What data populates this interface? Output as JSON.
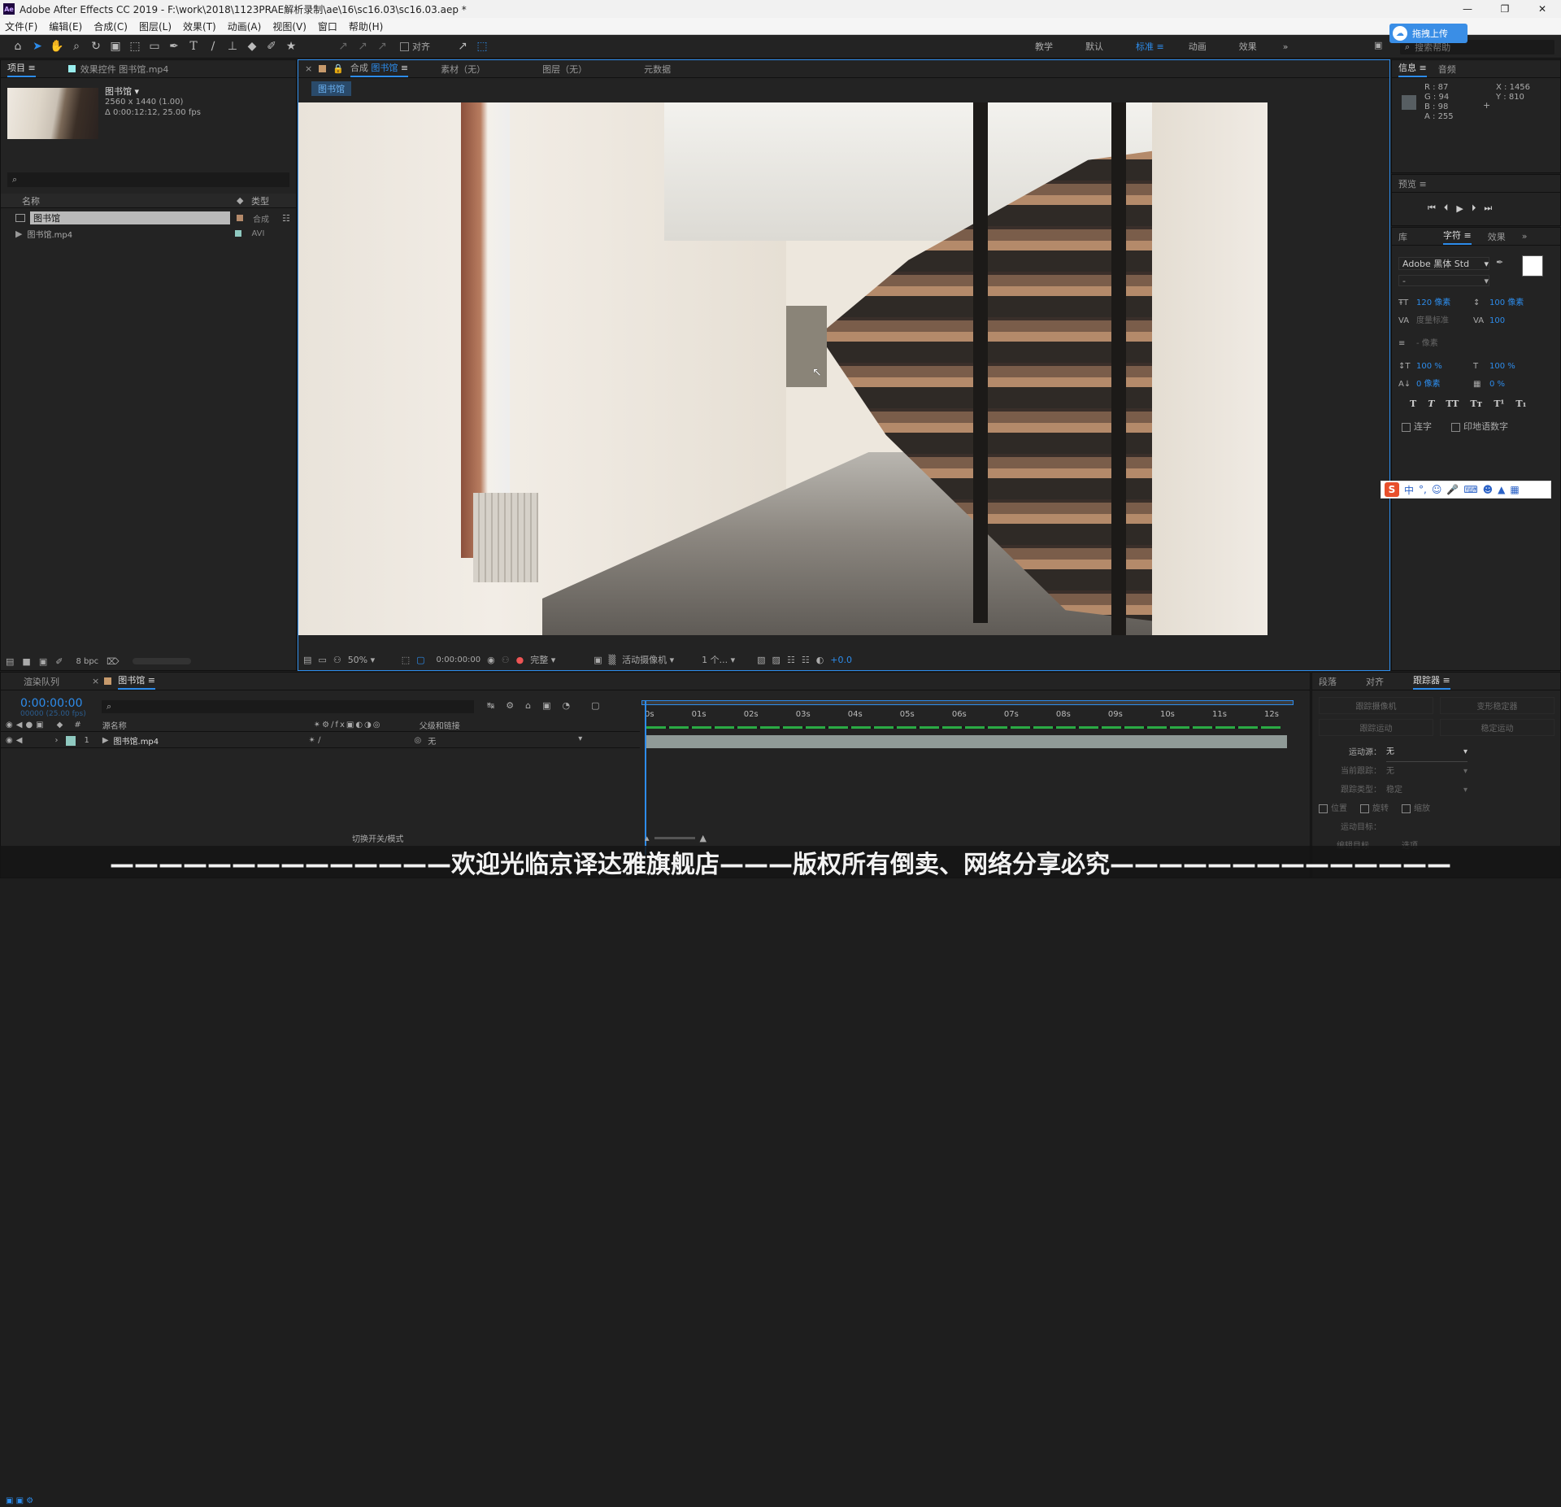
{
  "window": {
    "title": "Adobe After Effects CC 2019 - F:\\work\\2018\\1123PRAE解析录制\\ae\\16\\sc16.03\\sc16.03.aep *",
    "app_icon": "Ae"
  },
  "menu": [
    "文件(F)",
    "编辑(E)",
    "合成(C)",
    "图层(L)",
    "效果(T)",
    "动画(A)",
    "视图(V)",
    "窗口",
    "帮助(H)"
  ],
  "toolbar": {
    "align_label": "对齐",
    "workspaces": [
      "教学",
      "默认",
      "标准",
      "动画",
      "效果"
    ],
    "active_workspace": "标准",
    "search_placeholder": "搜索帮助",
    "upload_label": "拖拽上传"
  },
  "project": {
    "tab": "项目",
    "effects_tab": "效果控件 图书馆.mp4",
    "item_name": "图书馆",
    "item_size": "2560 x 1440 (1.00)",
    "item_duration": "Δ 0:00:12:12, 25.00 fps",
    "col_name": "名称",
    "col_type": "类型",
    "items": [
      {
        "name": "图书馆",
        "type": "合成"
      },
      {
        "name": "图书馆.mp4",
        "type": "AVI"
      }
    ],
    "bpc": "8 bpc"
  },
  "comp": {
    "tab_prefix": "合成",
    "tab_name": "图书馆",
    "footage_tab": "素材（无）",
    "layer_tab": "图层（无）",
    "meta_tab": "元数据",
    "breadcrumb": "图书馆",
    "zoom": "50%",
    "time": "0:00:00:00",
    "resolution": "完整",
    "camera": "活动摄像机",
    "views": "1 个...",
    "exposure": "+0.0"
  },
  "info": {
    "tab": "信息",
    "audio_tab": "音频",
    "r": "R : 87",
    "g": "G : 94",
    "b": "B : 98",
    "a": "A : 255",
    "x": "X : 1456",
    "y": "Y : 810"
  },
  "preview": {
    "tab": "预览"
  },
  "character": {
    "tabs": [
      "库",
      "字符",
      "效果"
    ],
    "font": "Adobe 黑体 Std",
    "style": "-",
    "size": "120 像素",
    "leading": "100 像素",
    "kerning": "度量标准",
    "tracking": "100",
    "stroke": "- 像素",
    "vscale": "100 %",
    "hscale": "100 %",
    "baseline": "0 像素",
    "tsume": "0 %",
    "ligature": "连字",
    "hindi": "印地语数字",
    "styles": [
      "T",
      "T",
      "TT",
      "Tт",
      "T¹",
      "T₁"
    ]
  },
  "timeline": {
    "render_tab": "渲染队列",
    "comp_tab": "图书馆",
    "timecode": "0:00:00:00",
    "timecode_sub": "00000 (25.00 fps)",
    "col_source": "源名称",
    "col_parent": "父级和链接",
    "layer_num": "1",
    "layer_name": "图书馆.mp4",
    "parent": "无",
    "ticks": [
      "0s",
      "01s",
      "02s",
      "03s",
      "04s",
      "05s",
      "06s",
      "07s",
      "08s",
      "09s",
      "10s",
      "11s",
      "12s"
    ],
    "switch_mode": "切换开关/模式"
  },
  "tracker": {
    "tabs": [
      "段落",
      "对齐",
      "跟踪器"
    ],
    "btn_camera": "跟踪摄像机",
    "btn_stabilize": "变形稳定器",
    "btn_motion": "跟踪运动",
    "btn_stab": "稳定运动",
    "source_label": "运动源：",
    "source_value": "无",
    "current_label": "当前跟踪：",
    "current_value": "无",
    "type_label": "跟踪类型：",
    "type_value": "稳定",
    "position": "位置",
    "rotation": "旋转",
    "scale": "缩放",
    "target_label": "运动目标：",
    "edit_target": "编辑目标",
    "options": "选项"
  },
  "ime": {
    "lang": "中"
  },
  "banner": "——————————————欢迎光临京译达雅旗舰店———版权所有倒卖、网络分享必究——————————————"
}
